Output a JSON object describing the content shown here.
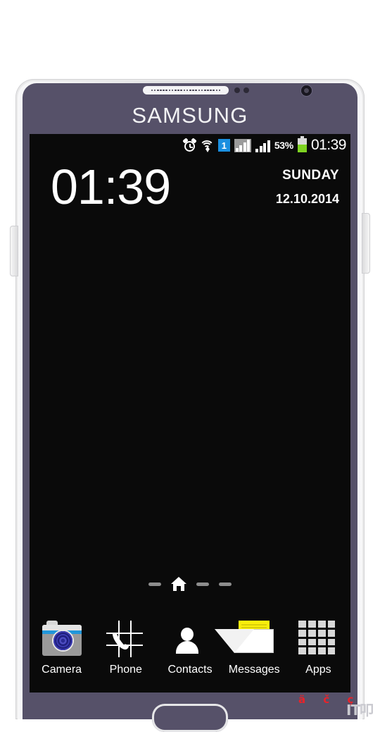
{
  "device": {
    "brand_logo": "SAMSUNG",
    "hardware": {
      "speaker": "earpiece-speaker",
      "front_camera": "front-camera",
      "sensors": "proximity-sensors",
      "volume_button": "volume-rocker",
      "power_button": "power-button",
      "home_button": "home-button"
    }
  },
  "statusbar": {
    "alarm_icon": "alarm-icon",
    "wifi_icon": "wifi-icon",
    "sim_label": "1",
    "signal1_icon": "signal-bars-sim1",
    "signal2_icon": "signal-bars-sim2",
    "battery_percent": "53%",
    "battery_level": 53,
    "battery_icon": "battery-icon",
    "clock": "01:39"
  },
  "clock_widget": {
    "time": "01:39",
    "day_of_week": "SUNDAY",
    "date": "12.10.2014"
  },
  "page_indicator": {
    "dots": [
      "dash",
      "home",
      "dash",
      "dash"
    ],
    "active_index": 1
  },
  "dock": {
    "items": [
      {
        "label": "Camera",
        "icon": "camera-icon"
      },
      {
        "label": "Phone",
        "icon": "phone-icon"
      },
      {
        "label": "Contacts",
        "icon": "contacts-icon"
      },
      {
        "label": "Messages",
        "icon": "messages-icon"
      },
      {
        "label": "Apps",
        "icon": "apps-grid-icon"
      }
    ]
  },
  "watermark": {
    "red_text": "ä č ç",
    "logo_text": "IT叩"
  },
  "colors": {
    "bezel": "#565169",
    "shell": "#e9e9ea",
    "screen": "#0a0a0a",
    "sim_badge": "#1a8fe0",
    "battery_fill": "#7ed321",
    "phone_green": "#0a8a3e",
    "contacts_orange": "#ef7f1a",
    "message_yellow": "#fbef0c",
    "camera_blue": "#2196d9",
    "watermark_red": "#e8232a"
  }
}
